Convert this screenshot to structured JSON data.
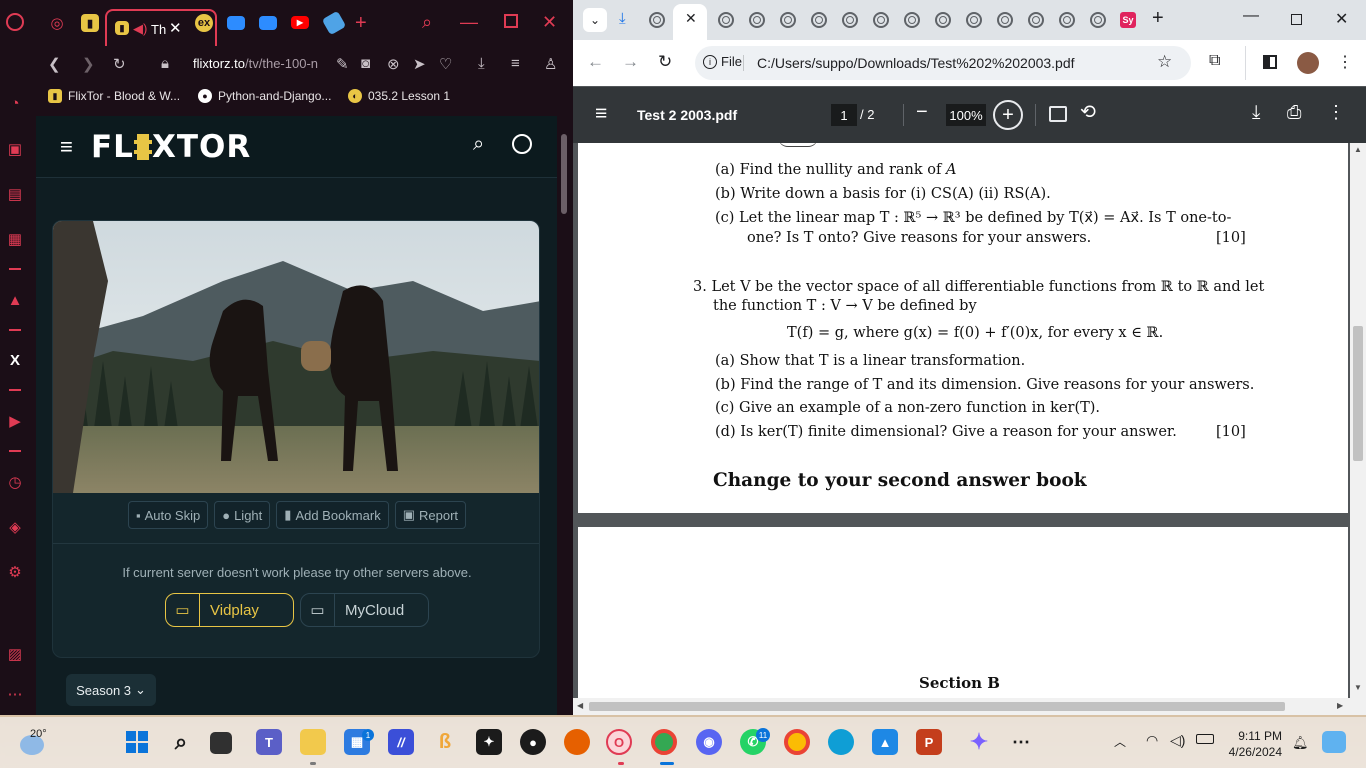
{
  "opera": {
    "active_tab_title": "Th",
    "url_host": "flixtorz.to",
    "url_path": "/tv/the-100-n",
    "bookmarks": [
      {
        "label": "FlixTor - Blood & W..."
      },
      {
        "label": "Python-and-Django..."
      },
      {
        "label": "035.2 Lesson 1"
      }
    ],
    "site": {
      "logo": "FL XTOR",
      "controls": [
        "Auto Skip",
        "Light",
        "Add Bookmark",
        "Report"
      ],
      "server_note": "If current server doesn't work please try other servers above.",
      "servers": [
        {
          "label": "Vidplay",
          "active": true
        },
        {
          "label": "MyCloud",
          "active": false
        }
      ],
      "season_label": "Season 3"
    }
  },
  "chrome": {
    "file_chip": "File",
    "url": "C:/Users/suppo/Downloads/Test%202%202003.pdf",
    "pdf_title": "Test 2 2003.pdf",
    "page_current": "1",
    "page_total": "/ 2",
    "zoom": "100%",
    "pdf": {
      "q2_a": "(a)  Find the nullity and rank of",
      "q2_a_var": "A",
      "q2_b": "(b)  Write down a basis for (i) CS(A)     (ii) RS(A).",
      "q2_c1": "(c)  Let the linear map T : ℝ⁵ → ℝ³ be defined by T(x⃗) = Ax⃗. Is T one-to-",
      "q2_c2": "one? Is T onto? Give reasons for your answers.",
      "q2_marks": "[10]",
      "q3_1": "3.  Let V be the vector space of all differentiable functions from ℝ to ℝ and let",
      "q3_2": "the function T : V → V be defined by",
      "q3_formula": "T(f) = g,  where g(x) = f(0) + f′(0)x,  for every x ∈ ℝ.",
      "q3_a": "(a)  Show that T is a linear transformation.",
      "q3_b": "(b)  Find the range of T and its dimension. Give reasons for your answers.",
      "q3_c": "(c)  Give an example of a non-zero function in ker(T).",
      "q3_d": "(d)  Is ker(T) finite dimensional? Give a reason for your answer.",
      "q3_marks": "[10]",
      "change_book": "Change to your second answer book",
      "section_b": "Section B"
    }
  },
  "taskbar": {
    "weather_temp": "20°",
    "teams_badge": "1",
    "whatsapp_badge": "11",
    "store_badge": "1",
    "time": "9:11 PM",
    "date": "4/26/2024"
  },
  "colors": {
    "opera_red": "#e03b54",
    "flixtor_yellow": "#e8c545",
    "chrome_toolbar": "#323639"
  }
}
